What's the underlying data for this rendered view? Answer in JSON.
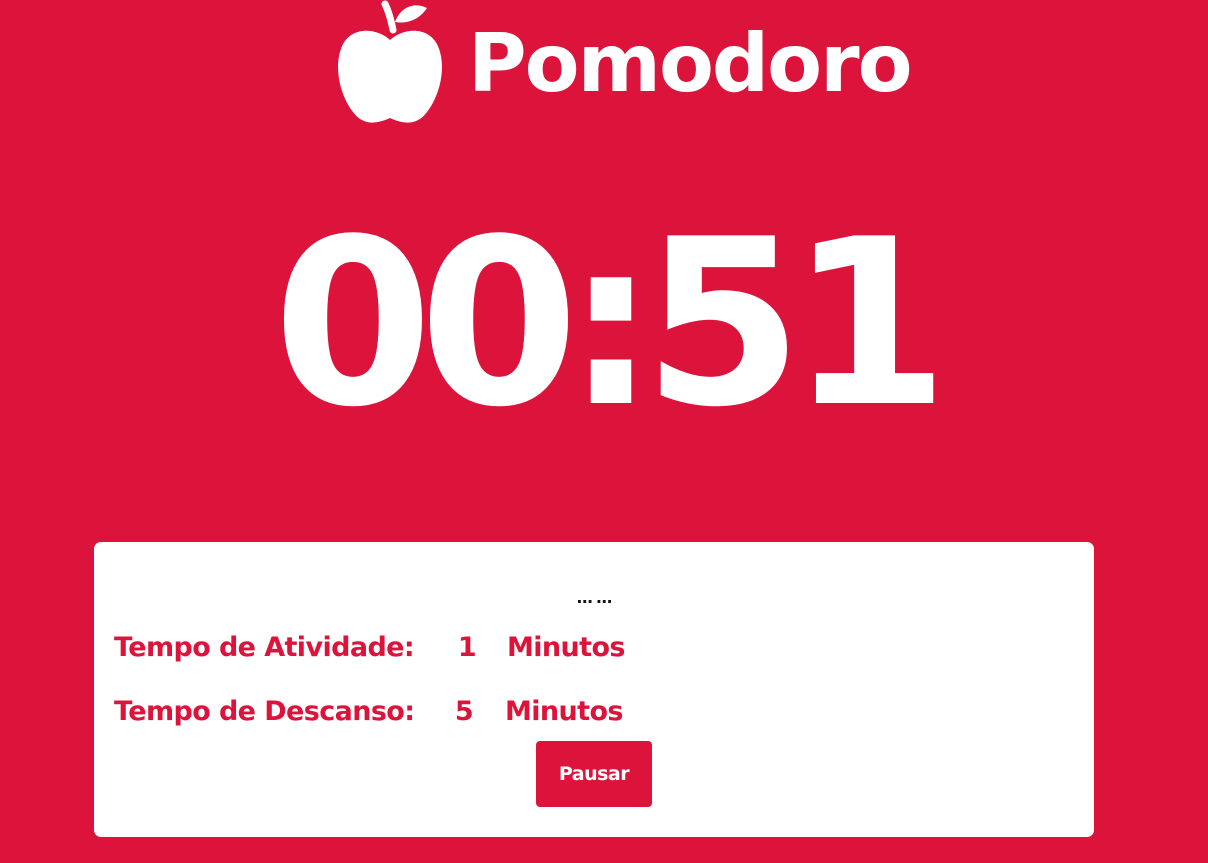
{
  "header": {
    "logo_icon": "apple-icon",
    "title": "Pomodoro"
  },
  "timer": {
    "display": "00:51"
  },
  "panel": {
    "status": "… …",
    "activity": {
      "label": "Tempo de Atividade:",
      "value": "1",
      "unit": "Minutos"
    },
    "rest": {
      "label": "Tempo de Descanso:",
      "value": "5",
      "unit": "Minutos"
    },
    "pause_button": "Pausar"
  },
  "colors": {
    "background": "#dc143c",
    "accent": "#dc143c",
    "panel": "#ffffff",
    "text_on_accent": "#ffffff"
  }
}
